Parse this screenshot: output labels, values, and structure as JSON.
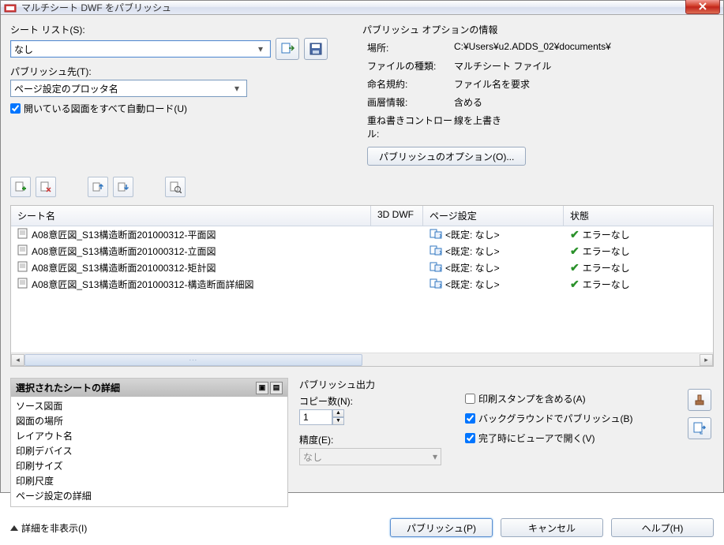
{
  "window": {
    "title": "マルチシート DWF をパブリッシュ"
  },
  "sheetlist": {
    "label": "シート リスト(S):",
    "value": "なし",
    "target_label": "パブリッシュ先(T):",
    "target_value": "ページ設定のプロッタ名",
    "autoload": "開いている図面をすべて自動ロード(U)"
  },
  "info": {
    "title": "パブリッシュ オプションの情報",
    "loc_label": "場所:",
    "loc_value": "C:¥Users¥u2.ADDS_02¥documents¥",
    "type_label": "ファイルの種類:",
    "type_value": "マルチシート ファイル",
    "naming_label": "命名規約:",
    "naming_value": "ファイル名を要求",
    "layer_label": "画層情報:",
    "layer_value": "含める",
    "merge_label": "重ね書きコントロール:",
    "merge_value": "線を上書き",
    "opt_button": "パブリッシュのオプション(O)..."
  },
  "columns": {
    "name": "シート名",
    "threed": "3D DWF",
    "page": "ページ設定",
    "status": "状態"
  },
  "rows": [
    {
      "name": "A08意匠図_S13構造断面201000312-平面図",
      "page": "<既定: なし>",
      "status": "エラーなし"
    },
    {
      "name": "A08意匠図_S13構造断面201000312-立面図",
      "page": "<既定: なし>",
      "status": "エラーなし"
    },
    {
      "name": "A08意匠図_S13構造断面201000312-矩計図",
      "page": "<既定: なし>",
      "status": "エラーなし"
    },
    {
      "name": "A08意匠図_S13構造断面201000312-構造断面詳細図",
      "page": "<既定: なし>",
      "status": "エラーなし"
    }
  ],
  "details": {
    "title": "選択されたシートの詳細",
    "items": [
      "ソース図面",
      "図面の場所",
      "レイアウト名",
      "印刷デバイス",
      "印刷サイズ",
      "印刷尺度",
      "ページ設定の詳細"
    ]
  },
  "output": {
    "title": "パブリッシュ出力",
    "copies_label": "コピー数(N):",
    "copies_value": "1",
    "precision_label": "精度(E):",
    "precision_value": "なし",
    "stamp": "印刷スタンプを含める(A)",
    "background": "バックグラウンドでパブリッシュ(B)",
    "viewer": "完了時にビューアで開く(V)"
  },
  "footer": {
    "hide": "詳細を非表示(I)",
    "publish": "パブリッシュ(P)",
    "cancel": "キャンセル",
    "help": "ヘルプ(H)"
  }
}
